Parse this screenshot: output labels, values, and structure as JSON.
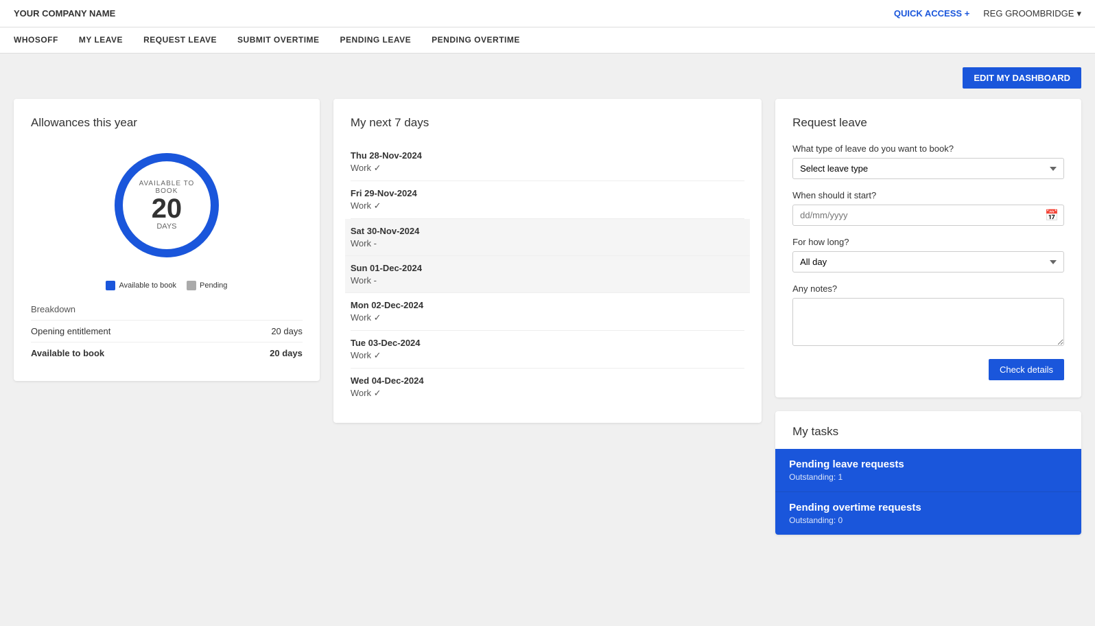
{
  "header": {
    "company_name": "YOUR COMPANY NAME",
    "quick_access_label": "QUICK ACCESS",
    "quick_access_icon": "+",
    "user_name": "REG GROOMBRIDGE",
    "user_chevron": "▾"
  },
  "nav": {
    "items": [
      {
        "id": "whosoff",
        "label": "WHOSOFF"
      },
      {
        "id": "my-leave",
        "label": "MY LEAVE"
      },
      {
        "id": "request-leave",
        "label": "REQUEST LEAVE"
      },
      {
        "id": "submit-overtime",
        "label": "SUBMIT OVERTIME"
      },
      {
        "id": "pending-leave",
        "label": "PENDING LEAVE"
      },
      {
        "id": "pending-overtime",
        "label": "PENDING OVERTIME"
      }
    ]
  },
  "dashboard": {
    "edit_button_label": "EDIT MY DASHBOARD"
  },
  "allowances_card": {
    "title": "Allowances this year",
    "donut": {
      "available_to_book_label": "AVAILABLE TO BOOK",
      "number": "20",
      "days_label": "DAYS"
    },
    "legend": {
      "available_label": "Available to book",
      "pending_label": "Pending"
    },
    "breakdown": {
      "title": "Breakdown",
      "rows": [
        {
          "label": "Opening entitlement",
          "value": "20 days"
        },
        {
          "label": "Available to book",
          "value": "20 days",
          "bold": true
        }
      ]
    }
  },
  "next7days_card": {
    "title": "My next 7 days",
    "days": [
      {
        "date": "Thu 28-Nov-2024",
        "work": "Work ✓",
        "weekend": false
      },
      {
        "date": "Fri 29-Nov-2024",
        "work": "Work ✓",
        "weekend": false
      },
      {
        "date": "Sat 30-Nov-2024",
        "work": "Work -",
        "weekend": true
      },
      {
        "date": "Sun 01-Dec-2024",
        "work": "Work -",
        "weekend": true
      },
      {
        "date": "Mon 02-Dec-2024",
        "work": "Work ✓",
        "weekend": false
      },
      {
        "date": "Tue 03-Dec-2024",
        "work": "Work ✓",
        "weekend": false
      },
      {
        "date": "Wed 04-Dec-2024",
        "work": "Work ✓",
        "weekend": false
      }
    ]
  },
  "request_leave_card": {
    "title": "Request leave",
    "leave_type_label": "What type of leave do you want to book?",
    "leave_type_placeholder": "Select leave type",
    "start_label": "When should it start?",
    "start_placeholder": "dd/mm/yyyy",
    "duration_label": "For how long?",
    "duration_placeholder": "All day",
    "notes_label": "Any notes?",
    "check_button_label": "Check details"
  },
  "tasks_card": {
    "title": "My tasks",
    "tasks": [
      {
        "title": "Pending leave requests",
        "subtitle": "Outstanding: 1"
      },
      {
        "title": "Pending overtime requests",
        "subtitle": "Outstanding: 0"
      }
    ]
  }
}
